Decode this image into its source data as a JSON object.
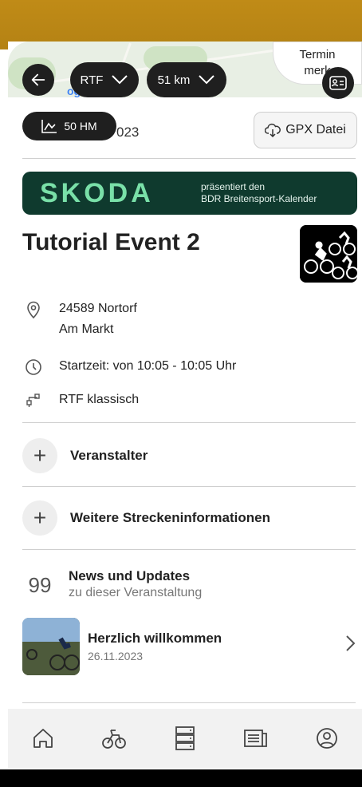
{
  "map": {
    "google_partial": "og",
    "termin_label_line1": "Termin",
    "termin_label_line2": "merk"
  },
  "top_pills": {
    "type_select": "RTF",
    "distance_select": "51 km",
    "elevation": "50 HM"
  },
  "date_partial": "023",
  "gpx_button": "GPX Datei",
  "banner": {
    "brand": "SKODA",
    "line1": "präsentiert den",
    "line2": "BDR Breitensport-Kalender"
  },
  "event": {
    "title": "Tutorial Event 2",
    "address_line1": "24589 Nortorf",
    "address_line2": "Am Markt",
    "start_time": "Startzeit: von 10:05 - 10:05 Uhr",
    "category": "RTF klassisch"
  },
  "sections": {
    "organizer": "Veranstalter",
    "route_info": "Weitere Streckeninformationen"
  },
  "news": {
    "title": "News und Updates",
    "subtitle": "zu dieser Veranstaltung",
    "quote_glyph": "99",
    "item_title": "Herzlich willkommen",
    "item_date": "26.11.2023"
  },
  "colors": {
    "top_bar": "#c08b17",
    "banner_bg": "#0f3a2e",
    "brand_green": "#79e0a8",
    "pill_dark": "#1f1f1f"
  },
  "tabbar": [
    "home-icon",
    "bike-icon",
    "list-icon",
    "news-icon",
    "profile-icon"
  ]
}
